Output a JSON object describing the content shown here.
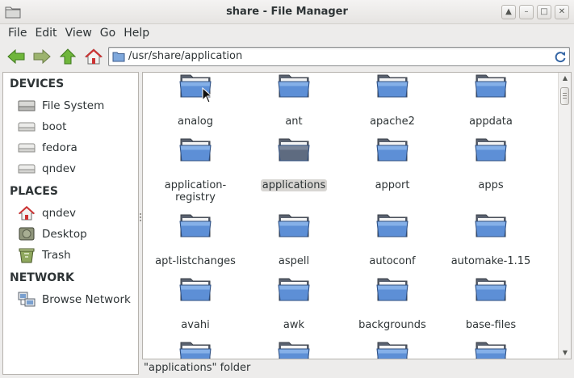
{
  "window": {
    "title": "share - File Manager",
    "controls": [
      "up-arrow-icon",
      "minimize-icon",
      "maximize-icon",
      "close-icon"
    ]
  },
  "menu": {
    "items": [
      "File",
      "Edit",
      "View",
      "Go",
      "Help"
    ]
  },
  "toolbar": {
    "back_icon": "back-arrow-icon",
    "forward_icon": "forward-arrow-icon",
    "up_icon": "up-arrow-icon",
    "home_icon": "home-icon",
    "location_value": "/usr/share/application",
    "reload_icon": "reload-icon"
  },
  "sidebar": {
    "sections": [
      {
        "heading": "DEVICES",
        "items": [
          {
            "label": "File System",
            "icon": "hard-drive-icon"
          },
          {
            "label": "boot",
            "icon": "drive-icon"
          },
          {
            "label": "fedora",
            "icon": "drive-icon"
          },
          {
            "label": "qndev",
            "icon": "drive-icon"
          }
        ]
      },
      {
        "heading": "PLACES",
        "items": [
          {
            "label": "qndev",
            "icon": "home-folder-icon"
          },
          {
            "label": "Desktop",
            "icon": "desktop-icon"
          },
          {
            "label": "Trash",
            "icon": "trash-icon"
          }
        ]
      },
      {
        "heading": "NETWORK",
        "items": [
          {
            "label": "Browse Network",
            "icon": "network-icon"
          }
        ]
      }
    ]
  },
  "files": [
    {
      "name": "analog"
    },
    {
      "name": "ant"
    },
    {
      "name": "apache2"
    },
    {
      "name": "appdata"
    },
    {
      "name": "application-\nregistry"
    },
    {
      "name": "applications",
      "selected": true
    },
    {
      "name": "apport"
    },
    {
      "name": "apps"
    },
    {
      "name": "apt-listchanges"
    },
    {
      "name": "aspell"
    },
    {
      "name": "autoconf"
    },
    {
      "name": "automake-1.15"
    },
    {
      "name": "avahi"
    },
    {
      "name": "awk"
    },
    {
      "name": "backgrounds"
    },
    {
      "name": "base-files"
    },
    {
      "name": ""
    },
    {
      "name": ""
    },
    {
      "name": ""
    },
    {
      "name": ""
    }
  ],
  "status": {
    "text": "\"applications\" folder"
  },
  "colors": {
    "folder_body": "#5d8fd6",
    "folder_light": "#8ab4ea",
    "folder_back": "#5a6270",
    "selection_bg": "#d8d6d3",
    "back_forward_green": "#5aa02c",
    "home_red": "#cc3333"
  }
}
